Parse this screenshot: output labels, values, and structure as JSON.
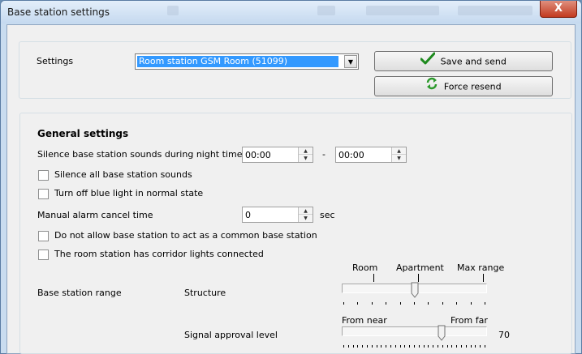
{
  "window": {
    "title": "Base station settings",
    "close_glyph": "X"
  },
  "top": {
    "settings_label": "Settings",
    "selected_station": "Room station GSM Room (51099)",
    "save_label": "Save and send",
    "force_label": "Force resend",
    "save_icon": "checkmark-icon",
    "force_icon": "refresh-icon"
  },
  "general": {
    "heading": "General settings",
    "silence_night_label": "Silence base station sounds during night time",
    "night_from": "00:00",
    "night_separator": "-",
    "night_to": "00:00",
    "silence_all_label": "Silence all base station sounds",
    "silence_all_checked": false,
    "blue_light_label": "Turn off blue light in normal state",
    "blue_light_checked": false,
    "manual_cancel_label": "Manual alarm cancel time",
    "manual_cancel_value": "0",
    "manual_cancel_unit": "sec",
    "not_common_label": "Do not allow base station to act as a common base station",
    "not_common_checked": false,
    "corridor_label": "The room station has corridor lights connected",
    "corridor_checked": false
  },
  "range": {
    "label": "Base station range",
    "structure_label": "Structure",
    "structure_marks": [
      "Room",
      "Apartment",
      "Max range"
    ],
    "structure_level": 0.5,
    "approval_label": "Signal approval level",
    "approval_from_near": "From near",
    "approval_from_far": "From far",
    "approval_value": "70",
    "approval_level": 0.7
  }
}
